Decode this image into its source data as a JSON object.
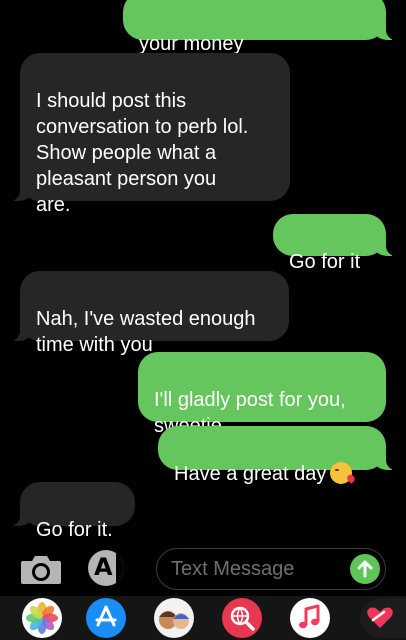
{
  "messages": [
    {
      "side": "out",
      "text": "your money"
    },
    {
      "side": "in",
      "text": "I should post this\nconversation to perb lol.\nShow people what a\npleasant person you\nare."
    },
    {
      "side": "out",
      "text": "Go for it"
    },
    {
      "side": "in",
      "text": "Nah, I've wasted enough\ntime with you"
    },
    {
      "side": "out",
      "text": "I'll gladly post for you,\nsweetie"
    },
    {
      "side": "out",
      "text": "Have a great day",
      "emoji": "kissing-face-emoji"
    },
    {
      "side": "in",
      "text": "Go for it."
    }
  ],
  "compose": {
    "placeholder": "Text Message",
    "camera_icon": "camera-icon",
    "apps_icon": "app-store-icon",
    "send_icon": "arrow-up-icon"
  },
  "drawer": {
    "apps": [
      "photos-app",
      "app-store-app",
      "memoji-app",
      "images-search-app",
      "music-app",
      "digital-touch-app"
    ]
  },
  "colors": {
    "incoming_bubble": "#262628",
    "outgoing_bubble": "#66c65e",
    "background": "#000000"
  }
}
